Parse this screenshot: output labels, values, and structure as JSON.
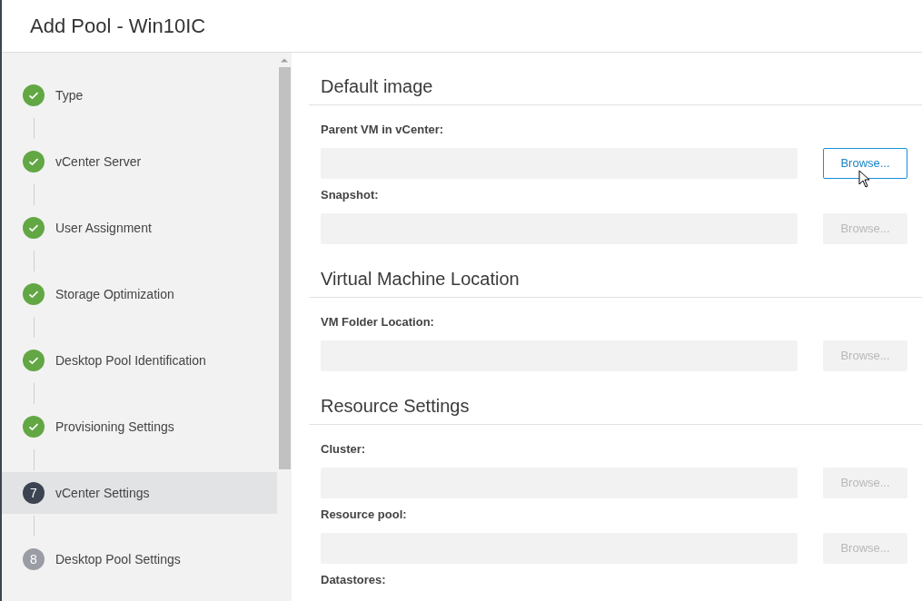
{
  "window": {
    "title": "Add Pool - Win10IC"
  },
  "steps": [
    {
      "label": "Type",
      "kind": "done",
      "selected": false
    },
    {
      "label": "vCenter Server",
      "kind": "done",
      "selected": false
    },
    {
      "label": "User Assignment",
      "kind": "done",
      "selected": false
    },
    {
      "label": "Storage Optimization",
      "kind": "done",
      "selected": false
    },
    {
      "label": "Desktop Pool Identification",
      "kind": "done",
      "selected": false
    },
    {
      "label": "Provisioning Settings",
      "kind": "done",
      "selected": false
    },
    {
      "label": "vCenter Settings",
      "kind": "current",
      "number": "7",
      "selected": true
    },
    {
      "label": "Desktop Pool Settings",
      "kind": "pending",
      "number": "8",
      "selected": false
    }
  ],
  "sections": [
    {
      "title": "Default image",
      "fields": [
        {
          "label": "Parent VM in vCenter:",
          "button": "Browse...",
          "disabled": false,
          "hovered": true
        },
        {
          "label": "Snapshot:",
          "button": "Browse...",
          "disabled": true,
          "hovered": false
        }
      ]
    },
    {
      "title": "Virtual Machine Location",
      "fields": [
        {
          "label": "VM Folder Location:",
          "button": "Browse...",
          "disabled": true,
          "hovered": false
        }
      ]
    },
    {
      "title": "Resource Settings",
      "fields": [
        {
          "label": "Cluster:",
          "button": "Browse...",
          "disabled": true,
          "hovered": false
        },
        {
          "label": "Resource pool:",
          "button": "Browse...",
          "disabled": true,
          "hovered": false
        },
        {
          "label": "Datastores:"
        }
      ]
    }
  ]
}
